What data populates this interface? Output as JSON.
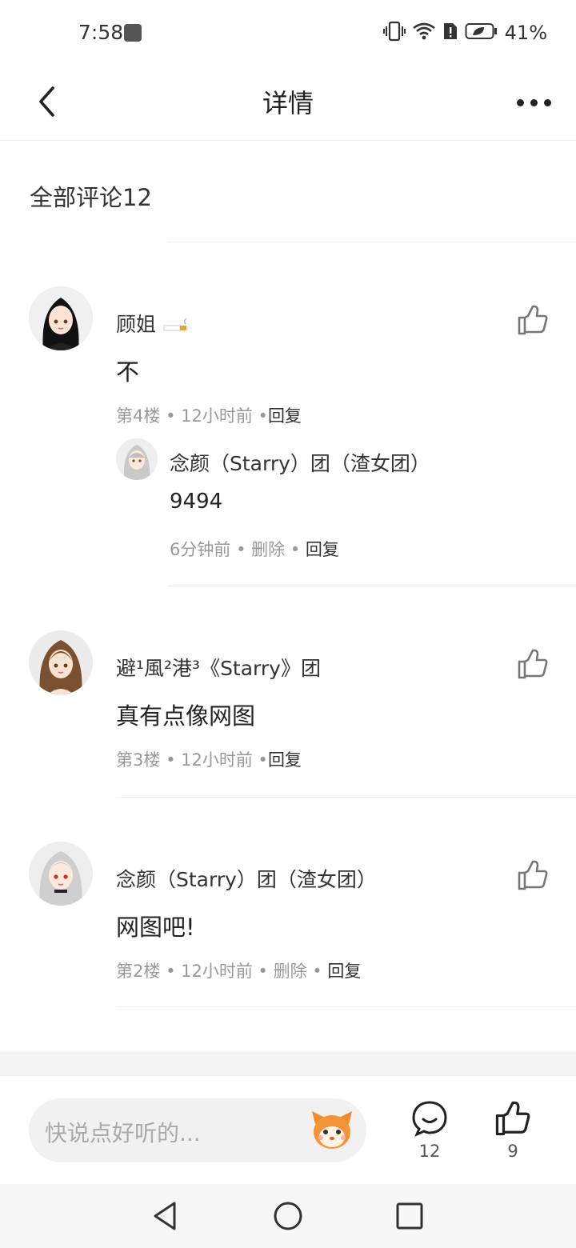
{
  "status": {
    "time": "7:58",
    "battery": "41%"
  },
  "header": {
    "title": "详情"
  },
  "comments_section": {
    "title": "全部评论12"
  },
  "comments": [
    {
      "username": "顾姐",
      "content": "不",
      "floor": "第4楼",
      "time": "12小时前",
      "reply": "回复",
      "subreply": {
        "username": "念颜（Starry）团（渣女团）",
        "content": "9494",
        "time": "6分钟前",
        "delete": "删除",
        "reply": "回复"
      }
    },
    {
      "username": "避¹風²港³《Starry》团",
      "content": "真有点像网图",
      "floor": "第3楼",
      "time": "12小时前",
      "reply": "回复"
    },
    {
      "username": "念颜（Starry）团（渣女团）",
      "content": "网图吧!",
      "floor": "第2楼",
      "time": "12小时前",
      "delete": "删除",
      "reply": "回复"
    }
  ],
  "input": {
    "placeholder": "快说点好听的..."
  },
  "actions": {
    "comment_count": "12",
    "like_count": "9"
  },
  "icons": {
    "back": "back-arrow-icon",
    "more": "more-dots-icon",
    "like": "thumbs-up-icon",
    "comment": "chat-bubble-icon",
    "mascot": "fox-mascot-icon"
  }
}
